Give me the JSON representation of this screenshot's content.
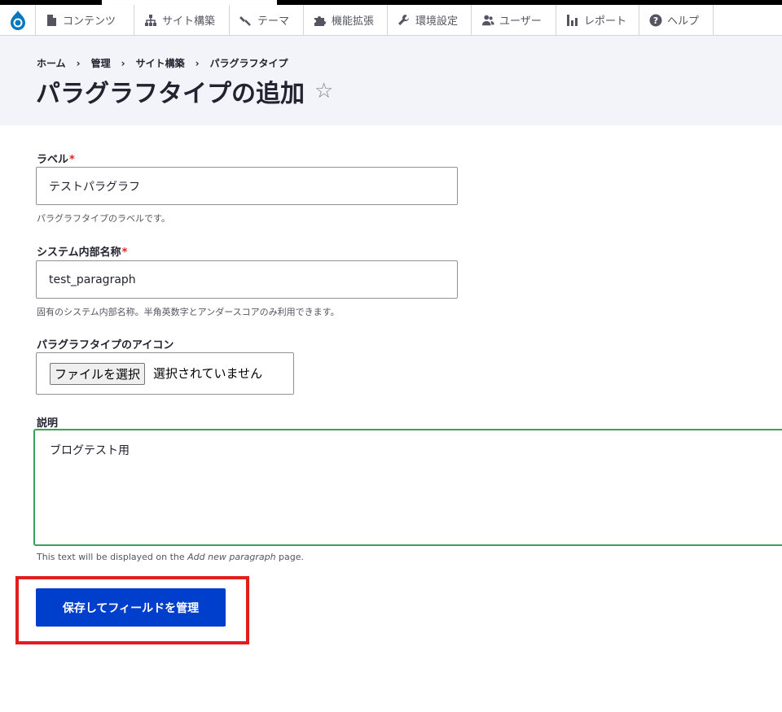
{
  "toolbar": {
    "items": [
      {
        "label": "コンテンツ",
        "icon": "file-icon"
      },
      {
        "label": "サイト構築",
        "icon": "sitemap-icon"
      },
      {
        "label": "テーマ",
        "icon": "paintbrush-icon"
      },
      {
        "label": "機能拡張",
        "icon": "puzzle-icon"
      },
      {
        "label": "環境設定",
        "icon": "wrench-icon"
      },
      {
        "label": "ユーザー",
        "icon": "users-icon"
      },
      {
        "label": "レポート",
        "icon": "bar-chart-icon"
      },
      {
        "label": "ヘルプ",
        "icon": "help-icon"
      }
    ]
  },
  "breadcrumb": [
    "ホーム",
    "管理",
    "サイト構築",
    "パラグラフタイプ"
  ],
  "page": {
    "title": "パラグラフタイプの追加",
    "favorite_icon": "☆"
  },
  "form": {
    "label": {
      "title": "ラベル",
      "required_mark": "*",
      "value": "テストパラグラフ",
      "description": "パラグラフタイプのラベルです。"
    },
    "machine_name": {
      "title": "システム内部名称",
      "required_mark": "*",
      "value": "test_paragraph",
      "description": "固有のシステム内部名称。半角英数字とアンダースコアのみ利用できます。"
    },
    "icon": {
      "title": "パラグラフタイプのアイコン",
      "button": "ファイルを選択",
      "status": "選択されていません"
    },
    "description": {
      "title": "説明",
      "value": "ブログテスト用",
      "help_prefix": "This text will be displayed on the ",
      "help_emphasis": "Add new paragraph",
      "help_suffix": " page."
    },
    "submit": "保存してフィールドを管理"
  },
  "colors": {
    "accent": "#003ecc",
    "highlight": "#e01e1e",
    "focus": "#3aa05b",
    "header_bg": "#f3f4f9"
  }
}
